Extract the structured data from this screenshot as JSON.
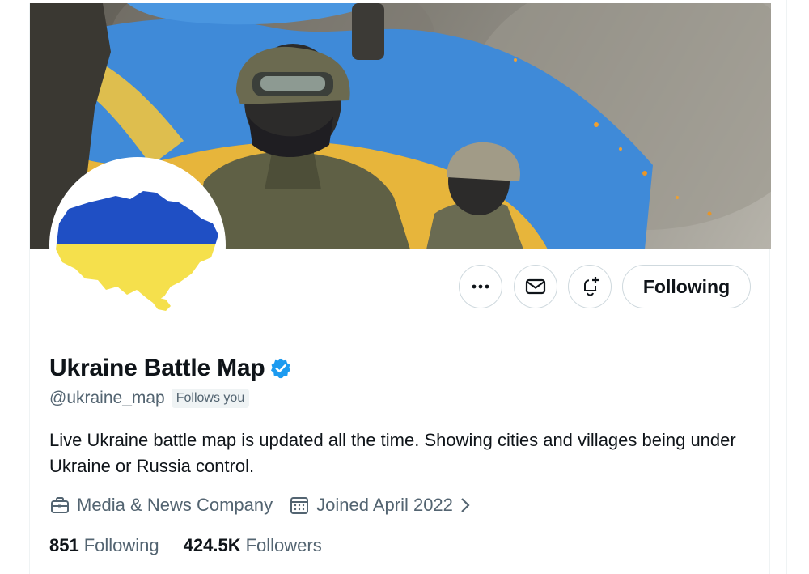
{
  "profile": {
    "display_name": "Ukraine Battle Map",
    "handle": "@ukraine_map",
    "follows_you": "Follows you",
    "bio": "Live Ukraine battle map is updated all the time. Showing cities and villages being under Ukraine or Russia control.",
    "category": "Media & News Company",
    "joined": "Joined April 2022"
  },
  "actions": {
    "more_icon": "ellipsis-icon",
    "message_icon": "envelope-icon",
    "notify_icon": "bell-plus-icon",
    "following_label": "Following"
  },
  "stats": {
    "following_count": "851",
    "following_label": "Following",
    "followers_count": "424.5K",
    "followers_label": "Followers"
  },
  "colors": {
    "verified_blue": "#1d9bf0",
    "flag_blue": "#1f4fc4",
    "flag_yellow": "#f5e04c",
    "secondary_text": "#536471"
  }
}
